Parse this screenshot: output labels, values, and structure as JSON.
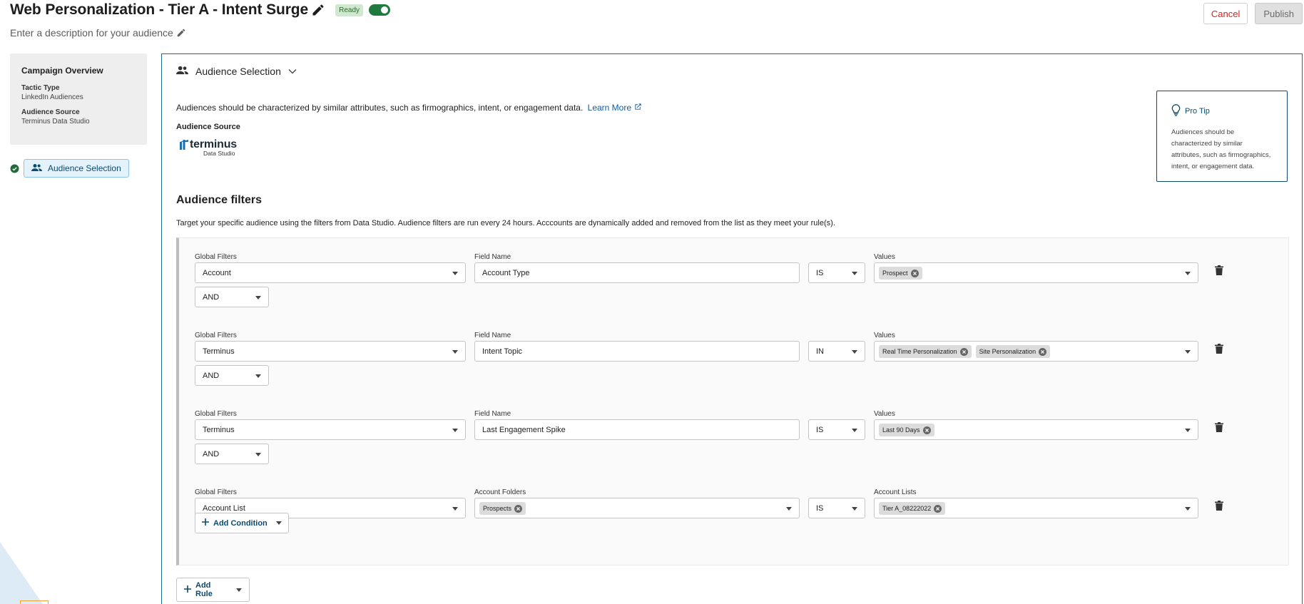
{
  "header": {
    "title": "Web Personalization - Tier A - Intent Surge",
    "status_badge": "Ready",
    "description_placeholder": "Enter a description for your audience",
    "cancel_label": "Cancel",
    "publish_label": "Publish",
    "toggle_on": true
  },
  "sidebar": {
    "overview_title": "Campaign Overview",
    "fields": [
      {
        "label": "Tactic Type",
        "value": "LinkedIn Audiences"
      },
      {
        "label": "Audience Source",
        "value": "Terminus Data Studio"
      }
    ],
    "step_label": "Audience Selection",
    "step_complete": true
  },
  "main": {
    "section_title": "Audience Selection",
    "intro_text": "Audiences should be characterized by similar attributes, such as firmographics, intent, or engagement data.",
    "learn_more": "Learn More",
    "audience_source_label": "Audience Source",
    "logo_text": "terminus",
    "logo_subtext": "Data Studio",
    "pro_tip": {
      "title": "Pro Tip",
      "body": "Audiences should be characterized by similar attributes, such as firmographics, intent, or engagement data."
    },
    "filters_title": "Audience filters",
    "filters_desc": "Target your specific audience using the filters from Data Studio. Audience filters are run every 24 hours. Acccounts are dynamically added and removed from the list as they meet your rule(s).",
    "conditions": [
      {
        "global_label": "Global Filters",
        "global_value": "Account",
        "field_label": "Field Name",
        "field_value": "Account Type",
        "operator": "IS",
        "values_label": "Values",
        "values": [
          "Prospect"
        ]
      },
      {
        "global_label": "Global Filters",
        "global_value": "Terminus",
        "field_label": "Field Name",
        "field_value": "Intent Topic",
        "operator": "IN",
        "values_label": "Values",
        "values": [
          "Real Time Personalization",
          "Site Personalization"
        ]
      },
      {
        "global_label": "Global Filters",
        "global_value": "Terminus",
        "field_label": "Field Name",
        "field_value": "Last Engagement Spike",
        "operator": "IS",
        "values_label": "Values",
        "values": [
          "Last 90 Days"
        ]
      },
      {
        "global_label": "Global Filters",
        "global_value": "Account List",
        "field_label": "Account Folders",
        "folders": [
          "Prospects"
        ],
        "operator": "IS",
        "values_label": "Account Lists",
        "values": [
          "Tier A_08222022"
        ]
      }
    ],
    "connectors": [
      "AND",
      "AND",
      "AND"
    ],
    "add_condition_label": "Add Condition",
    "add_rule_label": "Add Rule"
  },
  "colors": {
    "accent": "#0c4a6e",
    "panel_border": "#1d6a8c",
    "toggle_on": "#1f7a3f",
    "cancel_text": "#c62828",
    "link": "#0a5ea8"
  },
  "icons": [
    "pencil-icon",
    "users-icon",
    "chevron-down-icon",
    "external-link-icon",
    "lightbulb-icon",
    "check-circle-icon",
    "trash-icon",
    "close-circle-icon",
    "plus-icon"
  ]
}
